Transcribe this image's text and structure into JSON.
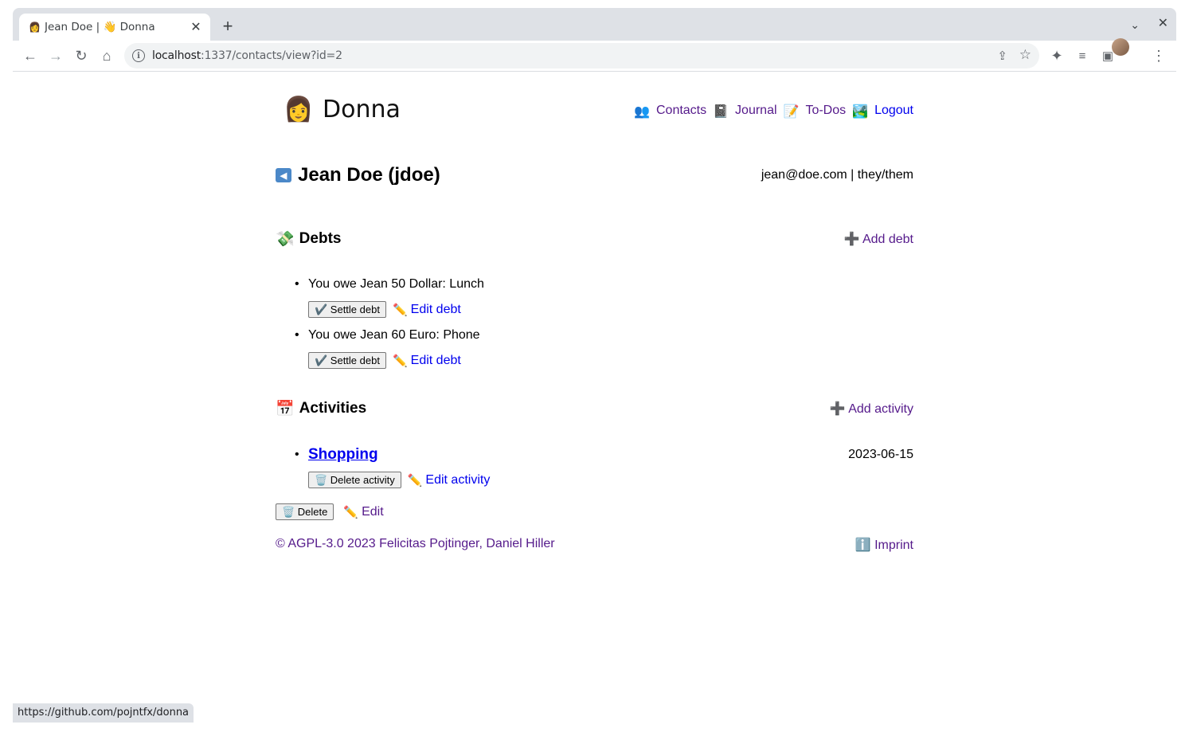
{
  "browser": {
    "tab_title": "Jean Doe | 👋 Donna",
    "url_host": "localhost",
    "url_rest": ":1337/contacts/view?id=2",
    "status_url": "https://github.com/pojntfx/donna"
  },
  "app": {
    "name": "Donna",
    "logo_emoji": "👩",
    "nav": [
      {
        "emoji": "👥",
        "label": "Contacts"
      },
      {
        "emoji": "📓",
        "label": "Journal"
      },
      {
        "emoji": "📝",
        "label": "To-Dos"
      },
      {
        "emoji": "🏞️",
        "label": "Logout"
      }
    ]
  },
  "contact": {
    "back_icon": "🔙",
    "title": "Jean Doe (jdoe)",
    "meta": "jean@doe.com | they/them"
  },
  "debts": {
    "emoji": "💸",
    "heading": "Debts",
    "add_label": "➕ Add debt",
    "items": [
      {
        "text": "You owe Jean 50 Dollar: Lunch",
        "settle_label": "✔️ Settle debt",
        "edit_label": "Edit debt"
      },
      {
        "text": "You owe Jean 60 Euro: Phone",
        "settle_label": "✔️ Settle debt",
        "edit_label": "Edit debt"
      }
    ]
  },
  "activities": {
    "emoji": "📅",
    "heading": "Activities",
    "add_label": "➕ Add activity",
    "items": [
      {
        "title": "Shopping",
        "date": "2023-06-15",
        "delete_label": "🗑️ Delete activity",
        "edit_label": "Edit activity"
      }
    ]
  },
  "actions": {
    "delete_label": "🗑️ Delete",
    "edit_label": "Edit"
  },
  "footer": {
    "copyright": "© AGPL-3.0 2023 Felicitas Pojtinger, Daniel Hiller",
    "imprint": "ℹ️ Imprint"
  },
  "icons": {
    "edit": "✏️"
  }
}
